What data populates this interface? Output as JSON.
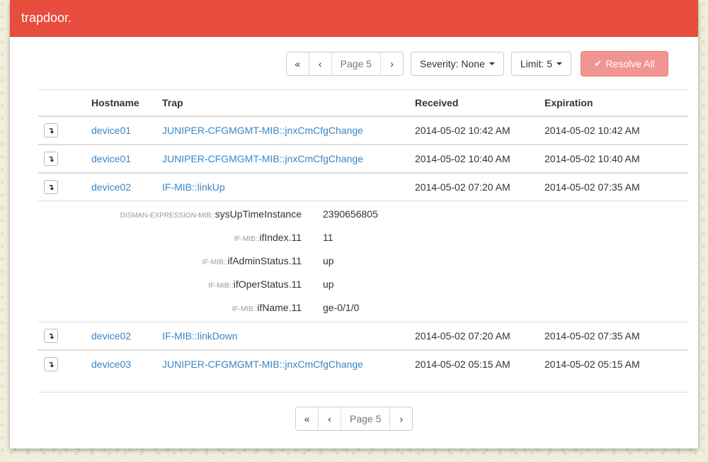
{
  "app": {
    "brand": "trapdoor."
  },
  "toolbar": {
    "first_label": "«",
    "prev_label": "‹",
    "page_label": "Page 5",
    "next_label": "›",
    "severity_label": "Severity: None",
    "limit_label": "Limit: 5",
    "resolve_icon": "✔",
    "resolve_label": "Resolve All"
  },
  "table": {
    "headers": {
      "hostname": "Hostname",
      "trap": "Trap",
      "received": "Received",
      "expiration": "Expiration"
    },
    "toggle_icon": "↴",
    "rows": [
      {
        "hostname": "device01",
        "trap": "JUNIPER-CFGMGMT-MIB::jnxCmCfgChange",
        "received": "2014-05-02 10:42 AM",
        "expiration": "2014-05-02 10:42 AM"
      },
      {
        "hostname": "device01",
        "trap": "JUNIPER-CFGMGMT-MIB::jnxCmCfgChange",
        "received": "2014-05-02 10:40 AM",
        "expiration": "2014-05-02 10:40 AM"
      },
      {
        "hostname": "device02",
        "trap": "IF-MIB::linkUp",
        "received": "2014-05-02 07:20 AM",
        "expiration": "2014-05-02 07:35 AM"
      },
      {
        "hostname": "device02",
        "trap": "IF-MIB::linkDown",
        "received": "2014-05-02 07:20 AM",
        "expiration": "2014-05-02 07:35 AM"
      },
      {
        "hostname": "device03",
        "trap": "JUNIPER-CFGMGMT-MIB::jnxCmCfgChange",
        "received": "2014-05-02 05:15 AM",
        "expiration": "2014-05-02 05:15 AM"
      }
    ],
    "detail": [
      {
        "mib": "DISMAN-EXPRESSION-MIB::",
        "name": "sysUpTimeInstance",
        "value": "2390656805"
      },
      {
        "mib": "IF-MIB::",
        "name": "ifIndex.11",
        "value": "11"
      },
      {
        "mib": "IF-MIB::",
        "name": "ifAdminStatus.11",
        "value": "up"
      },
      {
        "mib": "IF-MIB::",
        "name": "ifOperStatus.11",
        "value": "up"
      },
      {
        "mib": "IF-MIB::",
        "name": "ifName.11",
        "value": "ge-0/1/0"
      }
    ]
  },
  "bottom_pager": {
    "first_label": "«",
    "prev_label": "‹",
    "page_label": "Page 5",
    "next_label": "›"
  }
}
